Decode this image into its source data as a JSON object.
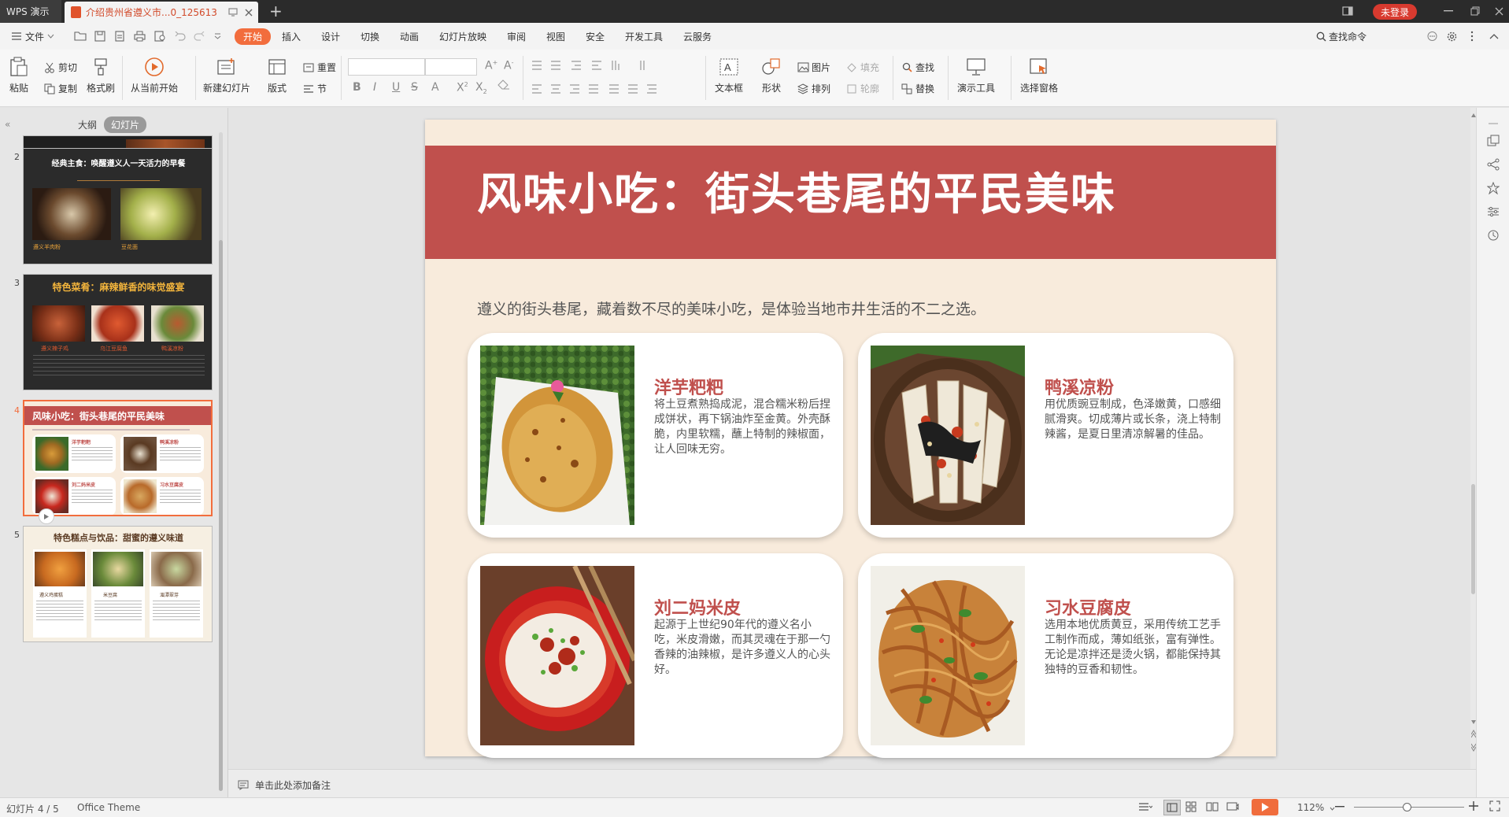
{
  "titlebar": {
    "app_tab": "WPS 演示",
    "doc_tab": "介绍贵州省遵义市...0_125613",
    "login_badge": "未登录"
  },
  "menubar": {
    "file": "文件",
    "start": "开始",
    "tabs": [
      "插入",
      "设计",
      "切换",
      "动画",
      "幻灯片放映",
      "审阅",
      "视图",
      "安全",
      "开发工具",
      "云服务"
    ],
    "search_command": "查找命令"
  },
  "ribbon": {
    "paste": "粘贴",
    "cut": "剪切",
    "copy": "复制",
    "format_painter": "格式刷",
    "from_start": "从当前开始",
    "new_slide": "新建幻灯片",
    "layout": "版式",
    "reset": "重置",
    "section": "节",
    "text_box": "文本框",
    "shape": "形状",
    "picture": "图片",
    "fill": "填充",
    "arrange": "排列",
    "outline": "轮廓",
    "find": "查找",
    "replace": "替换",
    "present_tools": "演示工具",
    "select_pane": "选择窗格"
  },
  "left_panel": {
    "outline_tab": "大纲",
    "slides_tab": "幻灯片",
    "thumbnails": [
      {
        "num": "2",
        "title": "经典主食：唤醒遵义人一天活力的早餐",
        "captions": [
          "遵义羊肉粉",
          "豆花面"
        ]
      },
      {
        "num": "3",
        "title": "特色菜肴：麻辣鲜香的味觉盛宴",
        "captions": [
          "遵义辣子鸡",
          "乌江豆腐鱼",
          "鸭溪凉粉"
        ]
      },
      {
        "num": "4",
        "title": "风味小吃：街头巷尾的平民美味",
        "captions": [
          "洋芋粑粑",
          "鸭溪凉粉",
          "刘二妈米皮",
          "习水豆腐皮"
        ]
      },
      {
        "num": "5",
        "title": "特色糕点与饮品：甜蜜的遵义味道",
        "captions": [
          "遵义鸡蛋糕",
          "米豆腐",
          "湄潭翠芽"
        ]
      }
    ]
  },
  "slide": {
    "title": "风味小吃：街头巷尾的平民美味",
    "intro": "遵义的街头巷尾，藏着数不尽的美味小吃，是体验当地市井生活的不二之选。",
    "cards": [
      {
        "title": "洋芋粑粑",
        "desc": "将土豆煮熟捣成泥，混合糯米粉后捏成饼状，再下锅油炸至金黄。外壳酥脆，内里软糯，蘸上特制的辣椒面，让人回味无穷。"
      },
      {
        "title": "鸭溪凉粉",
        "desc": "用优质豌豆制成，色泽嫩黄，口感细腻滑爽。切成薄片或长条，浇上特制辣酱，是夏日里清凉解暑的佳品。"
      },
      {
        "title": "刘二妈米皮",
        "desc": "起源于上世纪90年代的遵义名小吃，米皮滑嫩，而其灵魂在于那一勺香辣的油辣椒，是许多遵义人的心头好。"
      },
      {
        "title": "习水豆腐皮",
        "desc": "选用本地优质黄豆，采用传统工艺手工制作而成，薄如纸张，富有弹性。无论是凉拌还是烫火锅，都能保持其独特的豆香和韧性。"
      }
    ]
  },
  "notes": {
    "placeholder": "单击此处添加备注"
  },
  "status": {
    "slide_counter": "幻灯片 4 / 5",
    "theme": "Office Theme",
    "zoom": "112%"
  },
  "colors": {
    "accent": "#c0504d",
    "wps_orange": "#f26d3d",
    "slide_bg": "#f8ebdc"
  }
}
